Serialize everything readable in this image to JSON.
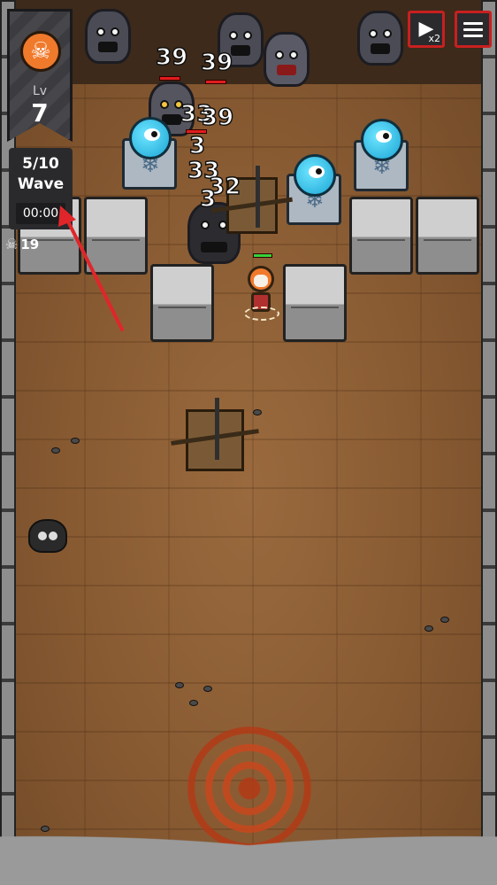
{
  "hud": {
    "level": {
      "label": "Lv",
      "value": "7"
    },
    "wave": {
      "count": "5/10",
      "label": "Wave",
      "timer": "00:00"
    },
    "kills": "19",
    "speed_button": {
      "multiplier": "x2"
    }
  },
  "damage_numbers": [
    "39",
    "39",
    "33",
    "39",
    "33",
    "32",
    "3",
    "3"
  ],
  "colors": {
    "hud_panel": "#2a2a2d",
    "button_border": "#c82020",
    "annotation_arrow": "#e0262a",
    "floor": "#8a5c33",
    "ice_crystal": "#1aa5d6",
    "player_flame": "#f07a2c"
  },
  "icons": [
    "fire-skull-icon",
    "skull-icon",
    "play-icon",
    "menu-icon",
    "snowflake-icon"
  ]
}
